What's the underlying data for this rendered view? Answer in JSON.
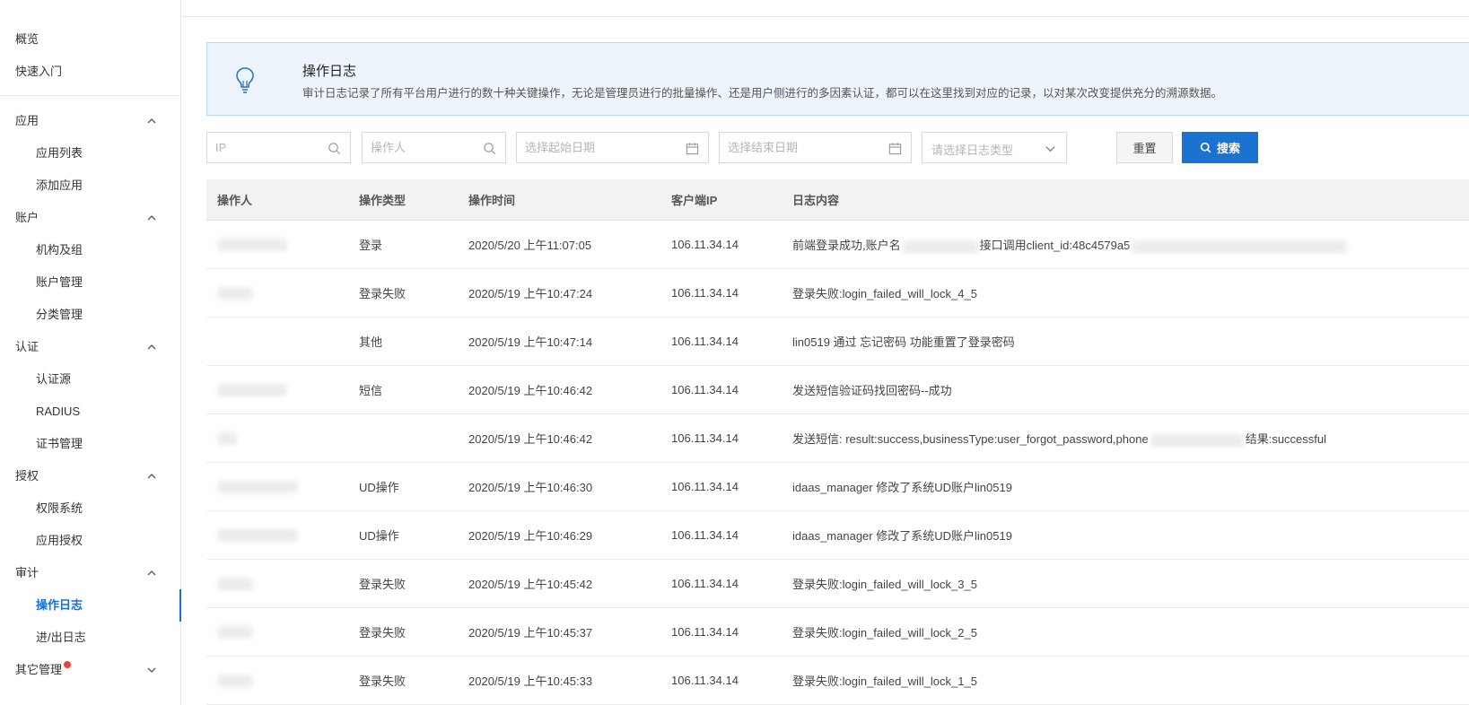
{
  "sidebar": {
    "top_links": [
      "概览",
      "快速入门"
    ],
    "groups": [
      {
        "label": "应用",
        "items": [
          "应用列表",
          "添加应用"
        ]
      },
      {
        "label": "账户",
        "items": [
          "机构及组",
          "账户管理",
          "分类管理"
        ]
      },
      {
        "label": "认证",
        "items": [
          "认证源",
          "RADIUS",
          "证书管理"
        ]
      },
      {
        "label": "授权",
        "items": [
          "权限系统",
          "应用授权"
        ]
      },
      {
        "label": "审计",
        "items": [
          "操作日志",
          "进/出日志"
        ],
        "active_item": "操作日志"
      },
      {
        "label": "其它管理",
        "items": [],
        "collapsed": true,
        "has_notification_dot": true
      }
    ]
  },
  "info": {
    "title": "操作日志",
    "description": "审计日志记录了所有平台用户进行的数十种关键操作，无论是管理员进行的批量操作、还是用户侧进行的多因素认证，都可以在这里找到对应的记录，以对某次改变提供充分的溯源数据。",
    "icon": "lightbulb-icon"
  },
  "filters": {
    "ip_placeholder": "IP",
    "operator_placeholder": "操作人",
    "start_date_placeholder": "选择起始日期",
    "end_date_placeholder": "选择结束日期",
    "log_type_placeholder": "请选择日志类型",
    "reset_label": "重置",
    "search_label": "搜索"
  },
  "table": {
    "columns": [
      "操作人",
      "操作类型",
      "操作时间",
      "客户端IP",
      "日志内容"
    ],
    "rows": [
      {
        "type": "登录",
        "time": "2020/5/20 上午11:07:05",
        "ip": "106.11.34.14",
        "content": "前端登录成功,账户名",
        "content2": "接口调用client_id:48c4579a5"
      },
      {
        "type": "登录失败",
        "time": "2020/5/19 上午10:47:24",
        "ip": "106.11.34.14",
        "content": "登录失败:login_failed_will_lock_4_5",
        "content2": ""
      },
      {
        "type": "其他",
        "time": "2020/5/19 上午10:47:14",
        "ip": "106.11.34.14",
        "content": "lin0519 通过 忘记密码 功能重置了登录密码",
        "content2": ""
      },
      {
        "type": "短信",
        "time": "2020/5/19 上午10:46:42",
        "ip": "106.11.34.14",
        "content": "发送短信验证码找回密码--成功",
        "content2": ""
      },
      {
        "type": "",
        "time": "2020/5/19 上午10:46:42",
        "ip": "106.11.34.14",
        "content": "发送短信: result:success,businessType:user_forgot_password,phone",
        "content2": "结果:successful"
      },
      {
        "type": "UD操作",
        "time": "2020/5/19 上午10:46:30",
        "ip": "106.11.34.14",
        "content": "idaas_manager 修改了系统UD账户lin0519",
        "content2": ""
      },
      {
        "type": "UD操作",
        "time": "2020/5/19 上午10:46:29",
        "ip": "106.11.34.14",
        "content": "idaas_manager 修改了系统UD账户lin0519",
        "content2": ""
      },
      {
        "type": "登录失败",
        "time": "2020/5/19 上午10:45:42",
        "ip": "106.11.34.14",
        "content": "登录失败:login_failed_will_lock_3_5",
        "content2": ""
      },
      {
        "type": "登录失败",
        "time": "2020/5/19 上午10:45:37",
        "ip": "106.11.34.14",
        "content": "登录失败:login_failed_will_lock_2_5",
        "content2": ""
      },
      {
        "type": "登录失败",
        "time": "2020/5/19 上午10:45:33",
        "ip": "106.11.34.14",
        "content": "登录失败:login_failed_will_lock_1_5",
        "content2": ""
      }
    ]
  },
  "colors": {
    "accent": "#1a73d1",
    "info_bg": "#eef4fb",
    "notification_dot": "#e8463b"
  }
}
